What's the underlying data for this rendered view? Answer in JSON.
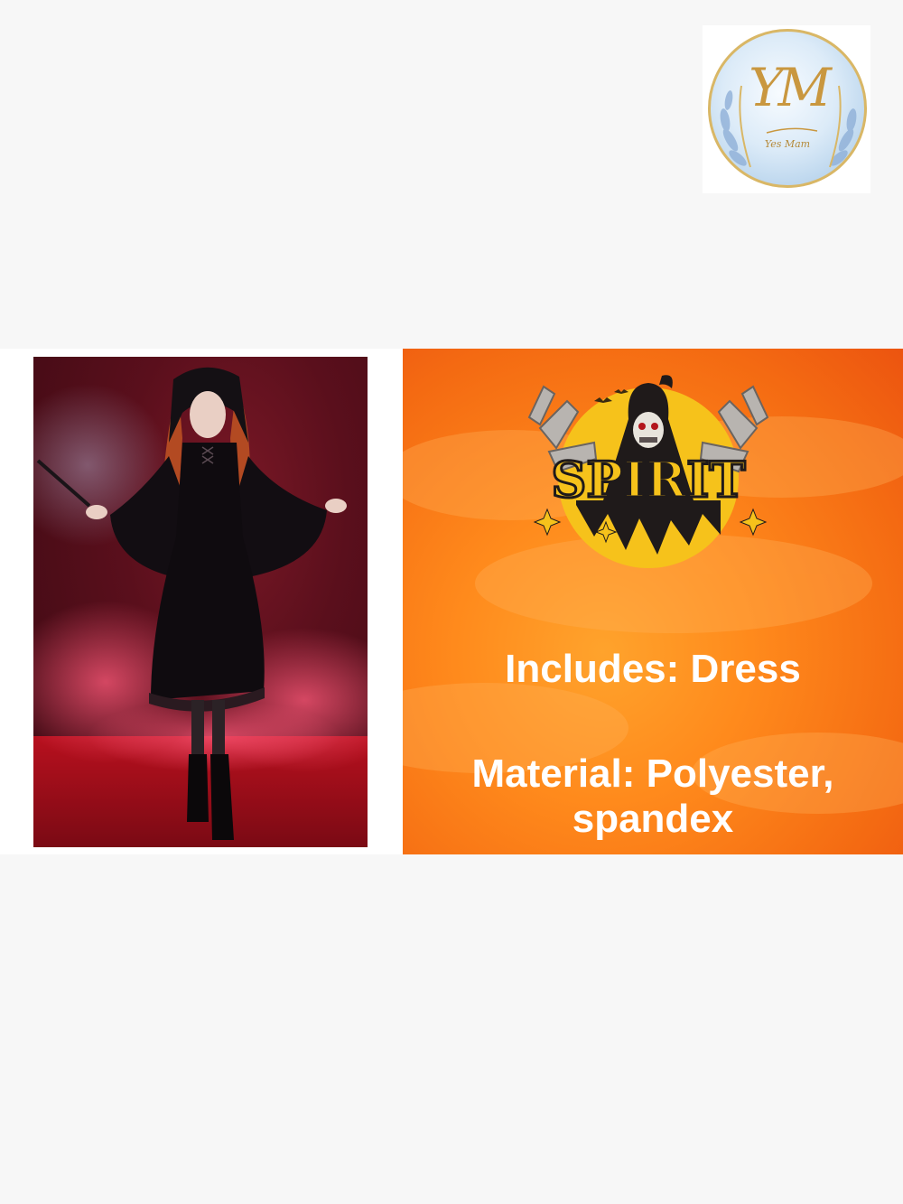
{
  "logo": {
    "icon": "yes-mam-logo",
    "monogram": "YM",
    "tagline": "Yes Mam"
  },
  "product_photo": {
    "icon": "witch-costume-photo"
  },
  "promo": {
    "brand": "SPIRIT",
    "brand_icon": "spirit-reaper-logo",
    "includes_text": "Includes: Dress",
    "material_line1": "Material: Polyester,",
    "material_line2": "spandex"
  },
  "colors": {
    "promo_orange": "#f46a12",
    "gold": "#c9973f",
    "spirit_yellow": "#f6c21b"
  }
}
